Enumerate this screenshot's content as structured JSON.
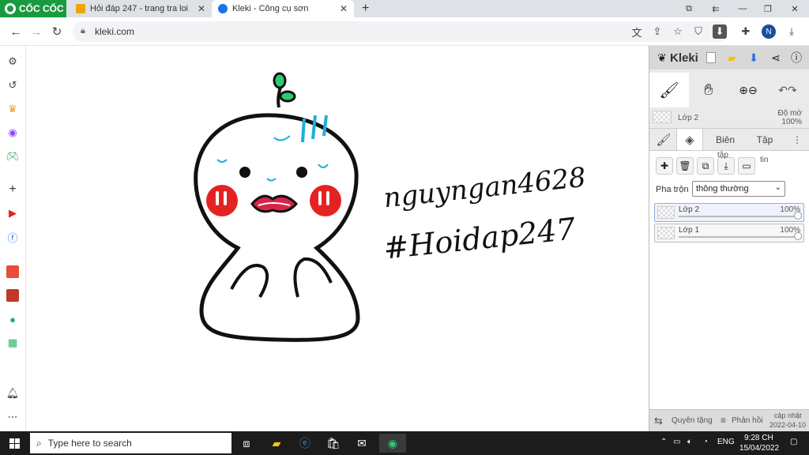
{
  "browser": {
    "brand": "CỐC CỐC",
    "tabs": [
      {
        "title": "Hỏi đáp 247 - trang tra loi",
        "favicon_color": "#f0a500"
      },
      {
        "title": "Kleki - Công cụ sơn",
        "favicon_color": "#1a73e8"
      }
    ],
    "url": "kleki.com",
    "profile_initial": "N"
  },
  "canvas": {
    "handwriting_line1": "nguyngan4628",
    "handwriting_line2": "#Hoidap247"
  },
  "kleki": {
    "brand": "Kleki",
    "opacity_label": "Độ mờ",
    "opacity_value": "100%",
    "current_layer": "Lớp 2",
    "tabs": {
      "edit": "Biên",
      "file": "Tập"
    },
    "blend_label": "Pha trộn",
    "blend_value": "thông thường",
    "layers": [
      {
        "name": "Lớp 2",
        "opacity": "100%"
      },
      {
        "name": "Lớp 1",
        "opacity": "100%"
      }
    ],
    "layer_btn_labels": {
      "file": "tập",
      "info": "tin"
    },
    "footer": {
      "donate": "Quyên tặng",
      "feedback": "Phản hồi",
      "update": "cập nhật",
      "date": "2022-04-10"
    }
  },
  "taskbar": {
    "search_placeholder": "Type here to search",
    "lang": "ENG",
    "time": "9:28 CH",
    "date": "15/04/2022"
  }
}
